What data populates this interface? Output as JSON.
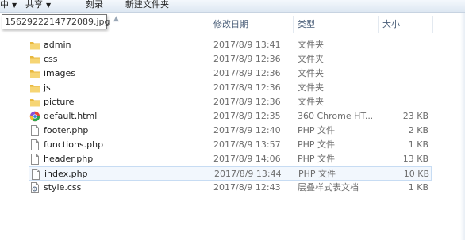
{
  "toolbar": {
    "items": [
      {
        "label": "中",
        "arrow": "▼"
      },
      {
        "label": "共享",
        "arrow": "▼"
      },
      {
        "label": "刻录",
        "arrow": ""
      },
      {
        "label": "新建文件夹",
        "arrow": ""
      }
    ]
  },
  "tooltip": {
    "text": "1562922214772089.jpg"
  },
  "columns": {
    "date": "修改日期",
    "type": "类型",
    "size": "大小"
  },
  "files": [
    {
      "name": "admin",
      "date": "2017/8/9 13:41",
      "type": "文件夹",
      "size": "",
      "icon": "folder-icon"
    },
    {
      "name": "css",
      "date": "2017/8/9 12:36",
      "type": "文件夹",
      "size": "",
      "icon": "folder-icon"
    },
    {
      "name": "images",
      "date": "2017/8/9 12:36",
      "type": "文件夹",
      "size": "",
      "icon": "folder-icon"
    },
    {
      "name": "js",
      "date": "2017/8/9 12:36",
      "type": "文件夹",
      "size": "",
      "icon": "folder-icon"
    },
    {
      "name": "picture",
      "date": "2017/8/9 12:36",
      "type": "文件夹",
      "size": "",
      "icon": "folder-icon"
    },
    {
      "name": "default.html",
      "date": "2017/8/9 12:35",
      "type": "360 Chrome HT...",
      "size": "23 KB",
      "icon": "chrome-html-icon"
    },
    {
      "name": "footer.php",
      "date": "2017/8/9 12:40",
      "type": "PHP 文件",
      "size": "2 KB",
      "icon": "file-icon"
    },
    {
      "name": "functions.php",
      "date": "2017/8/9 13:57",
      "type": "PHP 文件",
      "size": "1 KB",
      "icon": "file-icon"
    },
    {
      "name": "header.php",
      "date": "2017/8/9 14:06",
      "type": "PHP 文件",
      "size": "13 KB",
      "icon": "file-icon"
    },
    {
      "name": "index.php",
      "date": "2017/8/9 13:44",
      "type": "PHP 文件",
      "size": "10 KB",
      "icon": "file-icon",
      "selected": true
    },
    {
      "name": "style.css",
      "date": "2017/8/9 12:43",
      "type": "层叠样式表文档",
      "size": "1 KB",
      "icon": "css-file-icon"
    }
  ],
  "colors": {
    "folder": "#e8b83e",
    "selection": "#f2f7fd",
    "header_text": "#4c607a"
  }
}
